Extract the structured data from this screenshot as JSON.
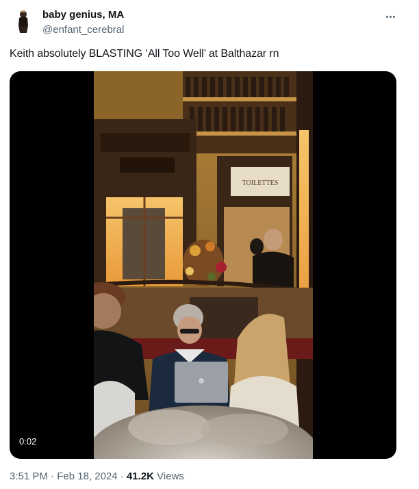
{
  "author": {
    "display_name": "baby genius, MA",
    "handle": "@enfant_cerebral",
    "avatar_icon": "avatar-figure-icon"
  },
  "tweet": {
    "text": "Keith absolutely BLASTING ‘All Too Well’ at Balthazar rn",
    "more_icon": "more-horizontal-icon"
  },
  "media": {
    "type": "video",
    "duration_badge": "0:02",
    "sign_text": "TOILETTES"
  },
  "meta": {
    "time": "3:51 PM",
    "separator1": " · ",
    "date": "Feb 18, 2024",
    "separator2": " · ",
    "views_count": "41.2K",
    "views_label": " Views"
  },
  "colors": {
    "text_primary": "#0f1419",
    "text_secondary": "#536471",
    "media_background": "#000000"
  }
}
